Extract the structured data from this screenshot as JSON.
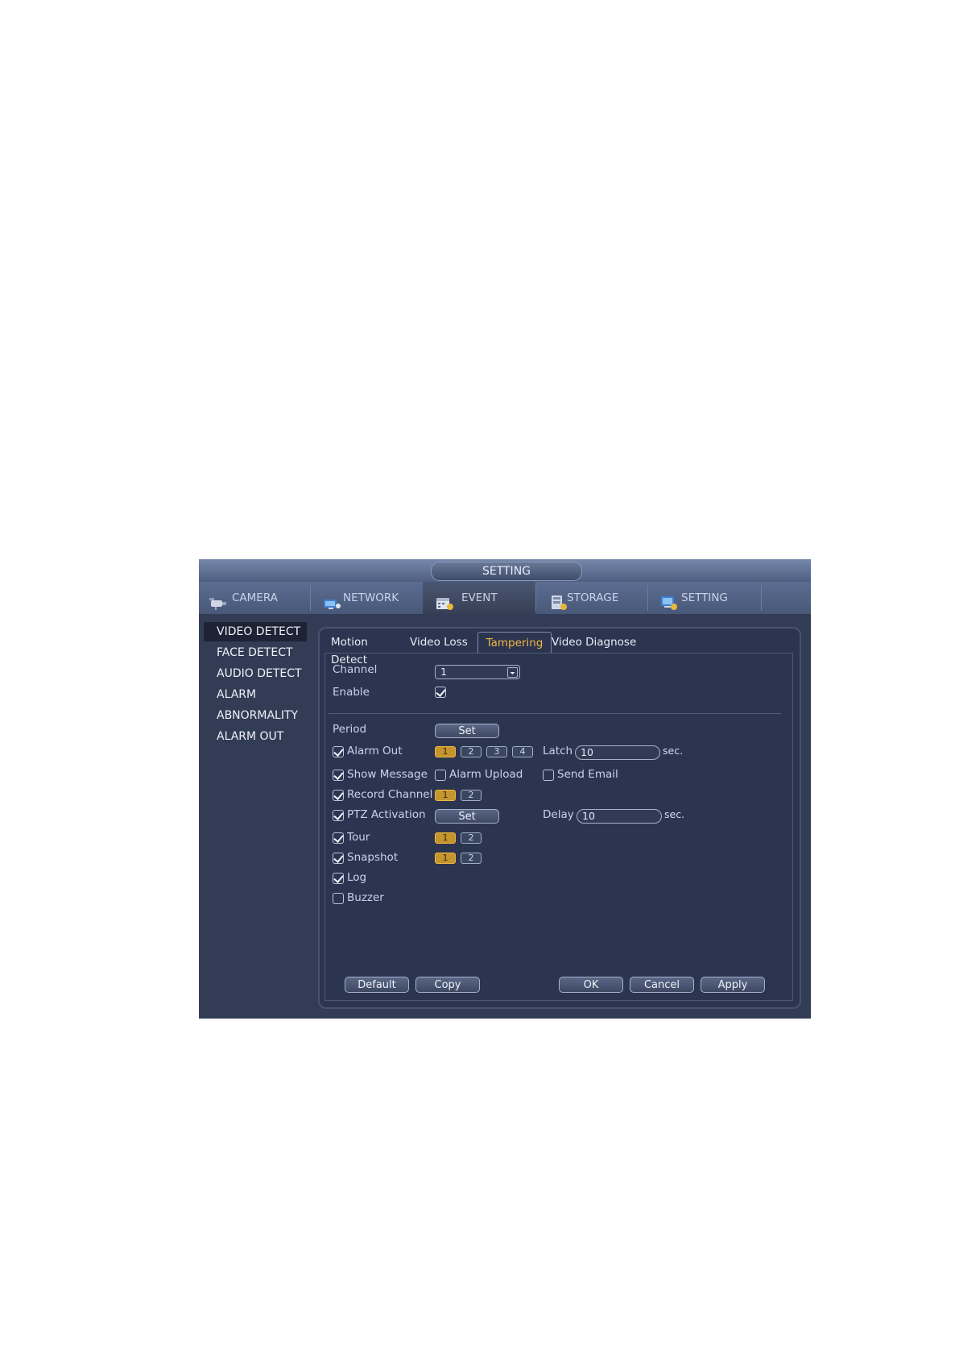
{
  "window": {
    "title": "SETTING"
  },
  "main_tabs": [
    {
      "label": "CAMERA",
      "icon": "camera-icon"
    },
    {
      "label": "NETWORK",
      "icon": "network-icon"
    },
    {
      "label": "EVENT",
      "icon": "event-icon",
      "active": true
    },
    {
      "label": "STORAGE",
      "icon": "storage-icon"
    },
    {
      "label": "SETTING",
      "icon": "settings-icon"
    }
  ],
  "sidebar": {
    "items": [
      {
        "label": "VIDEO DETECT",
        "active": true
      },
      {
        "label": "FACE DETECT"
      },
      {
        "label": "AUDIO DETECT"
      },
      {
        "label": "ALARM"
      },
      {
        "label": "ABNORMALITY"
      },
      {
        "label": "ALARM OUT"
      }
    ]
  },
  "sub_tabs": [
    {
      "label": "Motion Detect"
    },
    {
      "label": "Video Loss"
    },
    {
      "label": "Tampering",
      "active": true
    },
    {
      "label": "Video Diagnose"
    }
  ],
  "form": {
    "channel_label": "Channel",
    "channel_value": "1",
    "enable_label": "Enable",
    "enable_checked": true,
    "period_label": "Period",
    "period_button": "Set",
    "alarm_out_label": "Alarm Out",
    "alarm_out_checked": true,
    "alarm_out_channels": [
      "1",
      "2",
      "3",
      "4"
    ],
    "latch_label": "Latch",
    "latch_value": "10",
    "latch_unit": "sec.",
    "show_message_label": "Show Message",
    "show_message_checked": true,
    "alarm_upload_label": "Alarm Upload",
    "alarm_upload_checked": false,
    "send_email_label": "Send Email",
    "send_email_checked": false,
    "record_channel_label": "Record Channel",
    "record_channel_checked": true,
    "record_channels": [
      "1",
      "2"
    ],
    "ptz_label": "PTZ Activation",
    "ptz_checked": true,
    "ptz_button": "Set",
    "delay_label": "Delay",
    "delay_value": "10",
    "delay_unit": "sec.",
    "tour_label": "Tour",
    "tour_checked": true,
    "tour_channels": [
      "1",
      "2"
    ],
    "snapshot_label": "Snapshot",
    "snapshot_checked": true,
    "snapshot_channels": [
      "1",
      "2"
    ],
    "log_label": "Log",
    "log_checked": true,
    "buzzer_label": "Buzzer",
    "buzzer_checked": false
  },
  "buttons": {
    "default": "Default",
    "copy": "Copy",
    "ok": "OK",
    "cancel": "Cancel",
    "apply": "Apply"
  },
  "colors": {
    "accent": "#f2b640",
    "window_bg": "#323c55",
    "content_bg": "#2c3550"
  }
}
